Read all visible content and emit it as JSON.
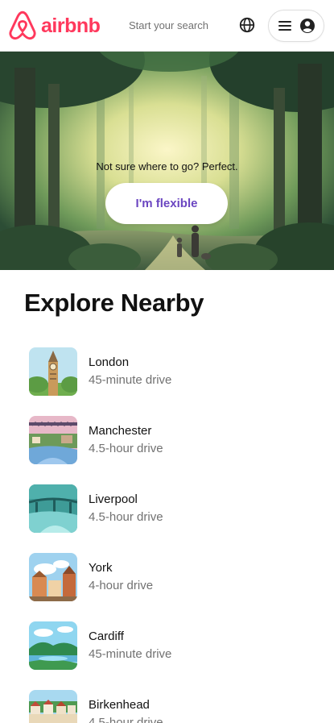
{
  "header": {
    "brand": "airbnb",
    "search_placeholder": "Start your search",
    "brand_color": "#FF385C"
  },
  "hero": {
    "tagline": "Not sure where to go? Perfect.",
    "button_label": "I'm flexible",
    "button_color": "#6b46c1"
  },
  "explore": {
    "title": "Explore Nearby",
    "items": [
      {
        "city": "London",
        "drive": "45-minute drive",
        "icon": "big-ben"
      },
      {
        "city": "Manchester",
        "drive": "4.5-hour drive",
        "icon": "bridge-canal"
      },
      {
        "city": "Liverpool",
        "drive": "4.5-hour drive",
        "icon": "bridge-river"
      },
      {
        "city": "York",
        "drive": "4-hour drive",
        "icon": "old-town"
      },
      {
        "city": "Cardiff",
        "drive": "45-minute drive",
        "icon": "lake-hills"
      },
      {
        "city": "Birkenhead",
        "drive": "4.5-hour drive",
        "icon": "village"
      }
    ]
  }
}
